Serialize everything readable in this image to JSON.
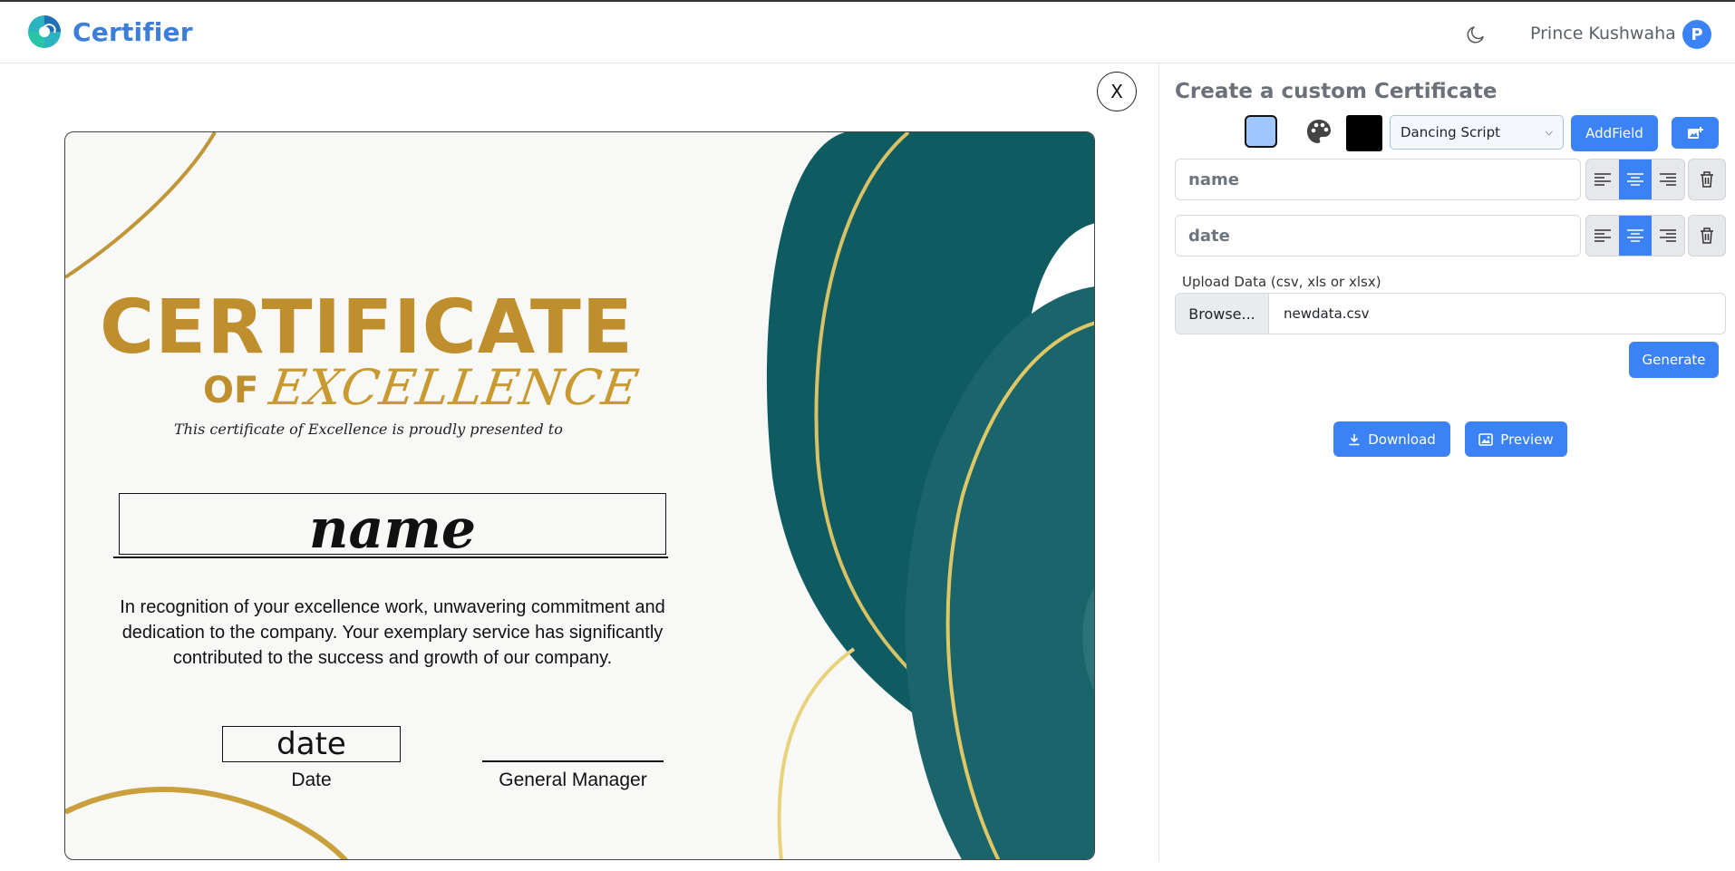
{
  "app": {
    "name": "Certifier"
  },
  "user": {
    "name": "Prince Kushwaha",
    "initial": "P"
  },
  "editor": {
    "close_label": "X"
  },
  "certificate": {
    "title": "CERTIFICATE",
    "of": "OF",
    "excellence": "EXCELLENCE",
    "presented": "This certificate of Excellence is proudly presented to",
    "name_field": "name",
    "recognition": "In recognition of your excellence work, unwavering commitment and dedication to the company. Your exemplary service has significantly contributed to the success and growth of our company.",
    "date_field": "date",
    "date_label": "Date",
    "signature_label": "General Manager"
  },
  "panel": {
    "title": "Create a custom Certificate",
    "background_color": "#9ec7ff",
    "text_color": "#000000",
    "font_select": "Dancing Script",
    "add_field_label": "AddField",
    "fields": [
      {
        "placeholder": "name",
        "alignment": "center"
      },
      {
        "placeholder": "date",
        "alignment": "center"
      }
    ],
    "upload_label": "Upload Data (csv, xls or xlsx)",
    "browse_label": "Browse...",
    "file_name": "newdata.csv",
    "generate_label": "Generate",
    "download_label": "Download",
    "preview_label": "Preview"
  },
  "colors": {
    "accent": "#3b82f6",
    "gold": "#c08f2d",
    "teal": "#0b5a60"
  }
}
